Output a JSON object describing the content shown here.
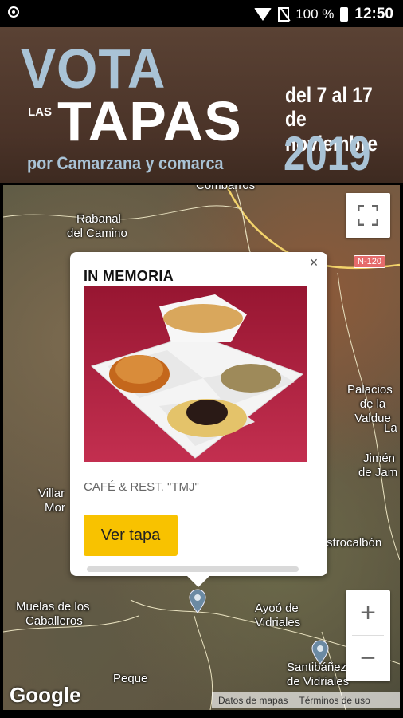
{
  "status_bar": {
    "battery": "100 %",
    "time": "12:50"
  },
  "banner": {
    "vota": "VOTA",
    "las": "LAS",
    "tapas": "TAPAS",
    "subtitle": "por Camarzana y comarca",
    "dates_line1": "del 7 al 17",
    "dates_line2": "de noviembre",
    "year": "2019"
  },
  "map": {
    "labels": {
      "combarros": "Combarros",
      "rabanal": "Rabanal",
      "del_camino": "del Camino",
      "palacios": "Palacios",
      "de_la_valdue": "de la Valdue",
      "la": "La",
      "jimen": "Jimén",
      "de_jam": "de Jam",
      "villar": "Villar",
      "mor": "Mor",
      "astrocalbon": "strocalbón",
      "muelas1": "Muelas de los",
      "muelas2": "Caballeros",
      "ayoo1": "Ayoó de",
      "ayoo2": "Vidriales",
      "peque": "Peque",
      "santibanez1": "Santibáñez",
      "santibanez2": "de Vidriales"
    },
    "road_badge": "N-120",
    "google_logo": "Google",
    "attribution": {
      "map_data": "Datos de mapas",
      "terms": "Términos de uso"
    },
    "zoom_in": "+",
    "zoom_out": "−",
    "fullscreen_icon": "fullscreen-icon",
    "pin_color": "#6b8aa3"
  },
  "popup": {
    "title": "IN MEMORIA",
    "close": "×",
    "venue": "CAFÉ & REST. \"TMJ\"",
    "button": "Ver tapa",
    "button_color": "#f8c200"
  }
}
